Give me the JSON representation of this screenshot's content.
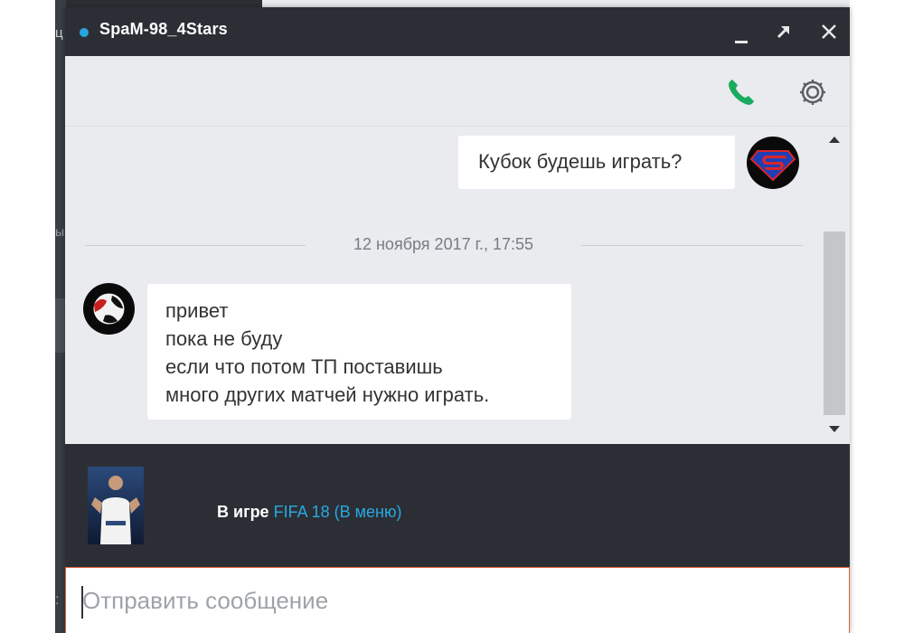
{
  "background": {
    "fragment_top": "ц",
    "fragment_mid": "ы",
    "fragment_bottom": ":"
  },
  "window": {
    "title": "SpaM-98_4Stars",
    "status_color": "#27a5e0",
    "popout_glyph": "↗",
    "close_glyph": "✕"
  },
  "toolbar": {
    "call_icon": "phone-icon",
    "settings_icon": "gear-icon",
    "call_color": "#1aab5e"
  },
  "messages": {
    "outgoing": {
      "text": "Кубок будешь играть?"
    },
    "date_separator": "12 ноября 2017 г., 17:55",
    "incoming": {
      "lines": [
        "привет",
        "пока не буду",
        "если что потом ТП поставишь",
        "много других матчей нужно играть."
      ]
    }
  },
  "game": {
    "label": "В игре",
    "title": "FIFA 18 (В меню)",
    "title_color": "#2aa7e5"
  },
  "composer": {
    "placeholder": "Отправить сообщение",
    "value": ""
  }
}
